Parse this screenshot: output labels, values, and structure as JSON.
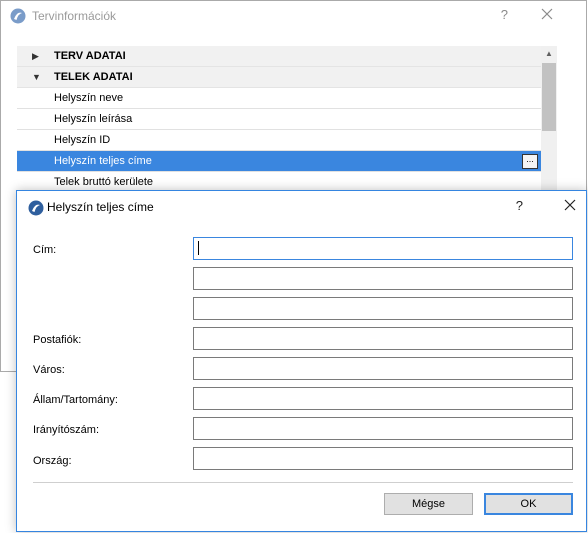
{
  "background_window": {
    "title": "Tervinformációk",
    "help_label": "?",
    "tree": [
      {
        "label": "TERV ADATAI",
        "type": "group",
        "expanded": false
      },
      {
        "label": "TELEK ADATAI",
        "type": "group",
        "expanded": true
      },
      {
        "label": "Helyszín neve",
        "type": "item"
      },
      {
        "label": "Helyszín leírása",
        "type": "item"
      },
      {
        "label": "Helyszín ID",
        "type": "item"
      },
      {
        "label": "Helyszín teljes címe",
        "type": "item",
        "selected": true,
        "button": "..."
      },
      {
        "label": "Telek bruttó kerülete",
        "type": "item"
      }
    ]
  },
  "dialog": {
    "title": "Helyszín teljes címe",
    "help_label": "?",
    "fields": {
      "cim_label": "Cím:",
      "postafiok_label": "Postafiók:",
      "varos_label": "Város:",
      "allam_label": "Állam/Tartomány:",
      "iranyitoszam_label": "Irányítószám:",
      "orszag_label": "Ország:"
    },
    "values": {
      "cim1": "",
      "cim2": "",
      "cim3": "",
      "postafiok": "",
      "varos": "",
      "allam": "",
      "iranyitoszam": "",
      "orszag": ""
    },
    "buttons": {
      "cancel": "Mégse",
      "ok": "OK"
    }
  },
  "colors": {
    "accent": "#3a86df",
    "selection": "#3a86df",
    "group_row_bg": "#f1f1f1"
  }
}
